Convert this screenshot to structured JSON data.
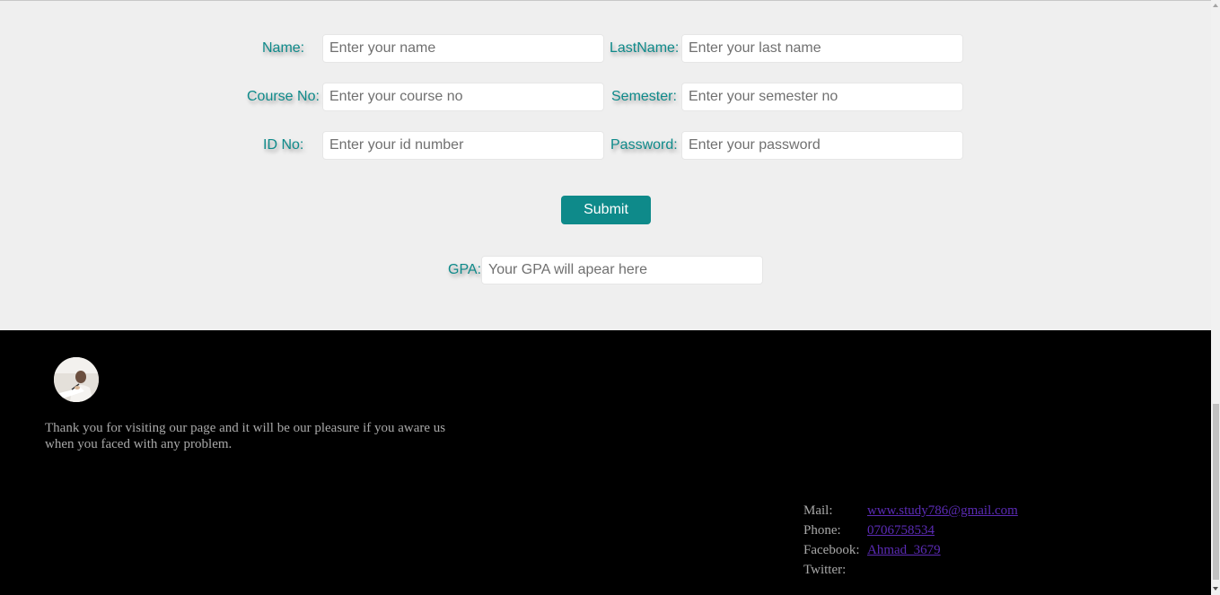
{
  "form": {
    "name_label": "Name:",
    "name_placeholder": "Enter your name",
    "lastname_label": "LastName:",
    "lastname_placeholder": "Enter your last name",
    "course_label": "Course No:",
    "course_placeholder": "Enter your course no",
    "semester_label": "Semester:",
    "semester_placeholder": "Enter your semester no",
    "id_label": "ID No:",
    "id_placeholder": "Enter your id number",
    "password_label": "Password:",
    "password_placeholder": "Enter your password",
    "submit_label": "Submit",
    "gpa_label": "GPA:",
    "gpa_placeholder": "Your GPA will apear here"
  },
  "footer": {
    "message": "Thank you for visiting our page and it will be our pleasure if you aware us when you faced with any problem.",
    "contacts": {
      "mail_label": "Mail:",
      "mail_value": "www.study786@gmail.com",
      "phone_label": "Phone:",
      "phone_value": "0706758534",
      "facebook_label": "Facebook:",
      "facebook_value": "Ahmad_3679",
      "twitter_label": "Twitter:",
      "twitter_value": ""
    }
  },
  "colors": {
    "accent": "#0e8a8a",
    "link": "#5b2bb5",
    "footer_bg": "#000000",
    "page_bg": "#efefef"
  }
}
